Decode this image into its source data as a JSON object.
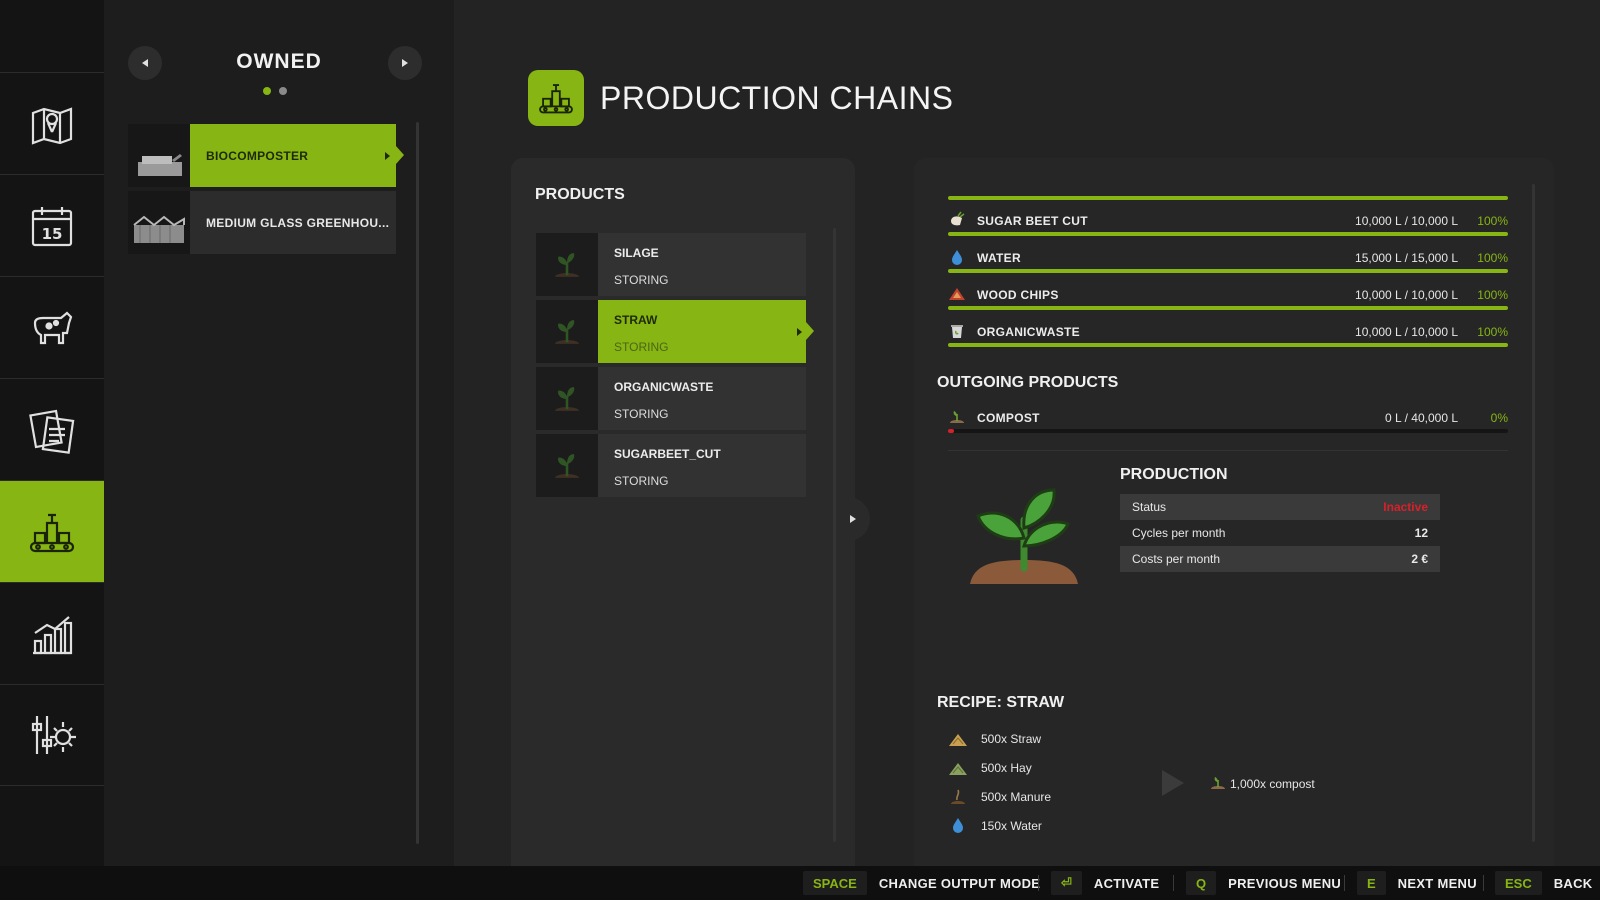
{
  "owned": {
    "title": "OWNED",
    "items": [
      {
        "label": "BIOCOMPOSTER",
        "active": true
      },
      {
        "label": "MEDIUM GLASS GREENHOU...",
        "active": false
      }
    ]
  },
  "header": {
    "title": "PRODUCTION CHAINS"
  },
  "products": {
    "title": "PRODUCTS",
    "items": [
      {
        "name": "SILAGE",
        "status": "STORING"
      },
      {
        "name": "STRAW",
        "status": "STORING"
      },
      {
        "name": "ORGANICWASTE",
        "status": "STORING"
      },
      {
        "name": "SUGARBEET_CUT",
        "status": "STORING"
      }
    ]
  },
  "details": {
    "incoming": [
      {
        "name": "SUGAR BEET CUT",
        "amount": "10,000 L / 10,000 L",
        "percent": "100%",
        "fill": 1.0,
        "icon": "sugarbeet-icon"
      },
      {
        "name": "WATER",
        "amount": "15,000 L / 15,000 L",
        "percent": "100%",
        "fill": 1.0,
        "icon": "water-drop-icon"
      },
      {
        "name": "WOOD CHIPS",
        "amount": "10,000 L / 10,000 L",
        "percent": "100%",
        "fill": 1.0,
        "icon": "woodchips-icon"
      },
      {
        "name": "ORGANICWASTE",
        "amount": "10,000 L / 10,000 L",
        "percent": "100%",
        "fill": 1.0,
        "icon": "organicwaste-icon"
      }
    ],
    "outgoing_title": "OUTGOING PRODUCTS",
    "outgoing": [
      {
        "name": "COMPOST",
        "amount": "0 L / 40,000 L",
        "percent": "0%",
        "fill": 0.01,
        "icon": "compost-icon"
      }
    ],
    "production": {
      "title": "PRODUCTION",
      "rows": [
        {
          "label": "Status",
          "value": "Inactive"
        },
        {
          "label": "Cycles per month",
          "value": "12"
        },
        {
          "label": "Costs per month",
          "value": "2 €"
        }
      ]
    },
    "recipe": {
      "title": "RECIPE: STRAW",
      "inputs": [
        "500x Straw",
        "500x Hay",
        "500x Manure",
        "150x Water"
      ],
      "output": "1,000x compost"
    }
  },
  "bottom_hints": [
    {
      "key": "SPACE",
      "label": "CHANGE OUTPUT MODE"
    },
    {
      "key": "⏎",
      "label": "ACTIVATE"
    },
    {
      "key": "Q",
      "label": "PREVIOUS MENU"
    },
    {
      "key": "E",
      "label": "NEXT MENU"
    },
    {
      "key": "ESC",
      "label": "BACK"
    }
  ],
  "colors": {
    "accent": "#87b513",
    "inactive": "#d8202a",
    "background": "#232323"
  }
}
